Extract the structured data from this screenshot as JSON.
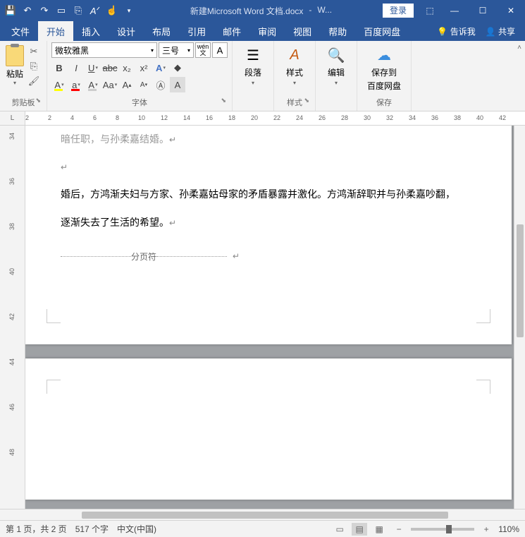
{
  "titlebar": {
    "doc_name": "新建Microsoft Word 文档.docx",
    "app_short": "W...",
    "login": "登录",
    "sep": "-"
  },
  "tabs": {
    "file": "文件",
    "home": "开始",
    "insert": "插入",
    "design": "设计",
    "layout": "布局",
    "references": "引用",
    "mail": "邮件",
    "review": "审阅",
    "view": "视图",
    "help": "帮助",
    "baidu": "百度网盘",
    "tellme": "告诉我",
    "share": "共享"
  },
  "ribbon": {
    "clipboard": {
      "paste": "粘贴",
      "label": "剪贴板"
    },
    "font": {
      "name": "微软雅黑",
      "size": "三号",
      "wen": "wén",
      "label": "字体"
    },
    "paragraph": {
      "button": "段落"
    },
    "styles": {
      "button": "样式",
      "label": "样式"
    },
    "editing": {
      "button": "编辑"
    },
    "save": {
      "button1": "保存到",
      "button2": "百度网盘",
      "label": "保存"
    }
  },
  "ruler": {
    "marks": [
      "2",
      "2",
      "4",
      "6",
      "8",
      "10",
      "12",
      "14",
      "16",
      "18",
      "20",
      "22",
      "24",
      "26",
      "28",
      "30",
      "32",
      "34",
      "36",
      "38",
      "40",
      "42"
    ]
  },
  "vruler": {
    "marks": [
      "34",
      "36",
      "38",
      "40",
      "42",
      "44",
      "46",
      "48"
    ]
  },
  "document": {
    "line0": "暗任职，与孙柔嘉结婚。",
    "line1": "婚后，方鸿渐夫妇与方家、孙柔嘉姑母家的矛盾暴露并激化。方鸿渐辞职并与孙柔嘉吵翻，",
    "line2": "逐渐失去了生活的希望。",
    "page_break": "分页符"
  },
  "statusbar": {
    "page": "第 1 页，共 2 页",
    "words": "517 个字",
    "lang": "中文(中国)",
    "zoom": "110%"
  }
}
